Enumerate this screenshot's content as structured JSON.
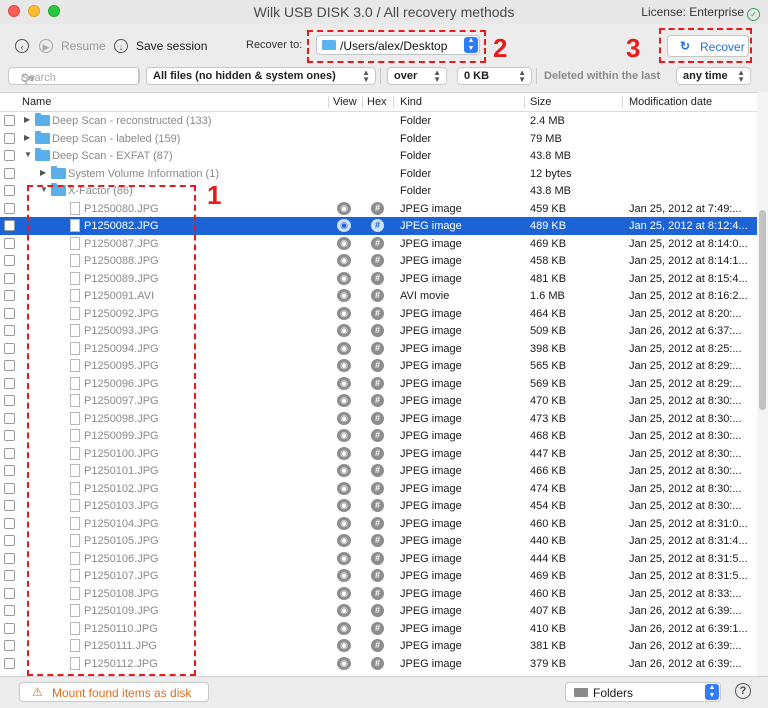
{
  "window": {
    "title": "Wilk USB DISK 3.0 / All recovery methods",
    "license": "License: Enterprise"
  },
  "toolbar": {
    "resume_label": "Resume",
    "save_session_label": "Save session",
    "recover_to_label": "Recover to:",
    "recover_path": "/Users/alex/Desktop",
    "recover_button": "Recover"
  },
  "annotations": {
    "one": "1",
    "two": "2",
    "three": "3"
  },
  "filters": {
    "search_placeholder": "Search",
    "file_filter": "All files (no hidden & system ones)",
    "size_op": "over",
    "size_value": "0 KB",
    "deleted_label": "Deleted within the last",
    "time_value": "any time"
  },
  "columns": {
    "name": "Name",
    "view": "View",
    "hex": "Hex",
    "kind": "Kind",
    "size": "Size",
    "modified": "Modification date"
  },
  "folders": [
    {
      "name": "Deep Scan - reconstructed (133)",
      "kind": "Folder",
      "size": "2.4 MB",
      "level": 0,
      "expanded": false
    },
    {
      "name": "Deep Scan - labeled (159)",
      "kind": "Folder",
      "size": "79 MB",
      "level": 0,
      "expanded": false
    },
    {
      "name": "Deep Scan - EXFAT (87)",
      "kind": "Folder",
      "size": "43.8 MB",
      "level": 0,
      "expanded": true
    },
    {
      "name": "System Volume Information (1)",
      "kind": "Folder",
      "size": "12 bytes",
      "level": 1,
      "expanded": false
    },
    {
      "name": "X-Factor (86)",
      "kind": "Folder",
      "size": "43.8 MB",
      "level": 1,
      "expanded": true
    }
  ],
  "files": [
    {
      "name": "P1250080.JPG",
      "kind": "JPEG image",
      "size": "459 KB",
      "date": "Jan 25, 2012 at 7:49:..."
    },
    {
      "name": "P1250082.JPG",
      "kind": "JPEG image",
      "size": "489 KB",
      "date": "Jan 25, 2012 at 8:12:4...",
      "selected": true
    },
    {
      "name": "P1250087.JPG",
      "kind": "JPEG image",
      "size": "469 KB",
      "date": "Jan 25, 2012 at 8:14:0..."
    },
    {
      "name": "P1250088.JPG",
      "kind": "JPEG image",
      "size": "458 KB",
      "date": "Jan 25, 2012 at 8:14:1..."
    },
    {
      "name": "P1250089.JPG",
      "kind": "JPEG image",
      "size": "481 KB",
      "date": "Jan 25, 2012 at 8:15:4..."
    },
    {
      "name": "P1250091.AVI",
      "kind": "AVI movie",
      "size": "1.6 MB",
      "date": "Jan 25, 2012 at 8:16:2..."
    },
    {
      "name": "P1250092.JPG",
      "kind": "JPEG image",
      "size": "464 KB",
      "date": "Jan 25, 2012 at 8:20:..."
    },
    {
      "name": "P1250093.JPG",
      "kind": "JPEG image",
      "size": "509 KB",
      "date": "Jan 26, 2012 at 6:37:..."
    },
    {
      "name": "P1250094.JPG",
      "kind": "JPEG image",
      "size": "398 KB",
      "date": "Jan 25, 2012 at 8:25:..."
    },
    {
      "name": "P1250095.JPG",
      "kind": "JPEG image",
      "size": "565 KB",
      "date": "Jan 25, 2012 at 8:29:..."
    },
    {
      "name": "P1250096.JPG",
      "kind": "JPEG image",
      "size": "569 KB",
      "date": "Jan 25, 2012 at 8:29:..."
    },
    {
      "name": "P1250097.JPG",
      "kind": "JPEG image",
      "size": "470 KB",
      "date": "Jan 25, 2012 at 8:30:..."
    },
    {
      "name": "P1250098.JPG",
      "kind": "JPEG image",
      "size": "473 KB",
      "date": "Jan 25, 2012 at 8:30:..."
    },
    {
      "name": "P1250099.JPG",
      "kind": "JPEG image",
      "size": "468 KB",
      "date": "Jan 25, 2012 at 8:30:..."
    },
    {
      "name": "P1250100.JPG",
      "kind": "JPEG image",
      "size": "447 KB",
      "date": "Jan 25, 2012 at 8:30:..."
    },
    {
      "name": "P1250101.JPG",
      "kind": "JPEG image",
      "size": "466 KB",
      "date": "Jan 25, 2012 at 8:30:..."
    },
    {
      "name": "P1250102.JPG",
      "kind": "JPEG image",
      "size": "474 KB",
      "date": "Jan 25, 2012 at 8:30:..."
    },
    {
      "name": "P1250103.JPG",
      "kind": "JPEG image",
      "size": "454 KB",
      "date": "Jan 25, 2012 at 8:30:..."
    },
    {
      "name": "P1250104.JPG",
      "kind": "JPEG image",
      "size": "460 KB",
      "date": "Jan 25, 2012 at 8:31:0..."
    },
    {
      "name": "P1250105.JPG",
      "kind": "JPEG image",
      "size": "440 KB",
      "date": "Jan 25, 2012 at 8:31:4..."
    },
    {
      "name": "P1250106.JPG",
      "kind": "JPEG image",
      "size": "444 KB",
      "date": "Jan 25, 2012 at 8:31:5..."
    },
    {
      "name": "P1250107.JPG",
      "kind": "JPEG image",
      "size": "469 KB",
      "date": "Jan 25, 2012 at 8:31:5..."
    },
    {
      "name": "P1250108.JPG",
      "kind": "JPEG image",
      "size": "460 KB",
      "date": "Jan 25, 2012 at 8:33:..."
    },
    {
      "name": "P1250109.JPG",
      "kind": "JPEG image",
      "size": "407 KB",
      "date": "Jan 26, 2012 at 6:39:..."
    },
    {
      "name": "P1250110.JPG",
      "kind": "JPEG image",
      "size": "410 KB",
      "date": "Jan 26, 2012 at 6:39:1..."
    },
    {
      "name": "P1250111.JPG",
      "kind": "JPEG image",
      "size": "381 KB",
      "date": "Jan 26, 2012 at 6:39:..."
    },
    {
      "name": "P1250112.JPG",
      "kind": "JPEG image",
      "size": "379 KB",
      "date": "Jan 26, 2012 at 6:39:..."
    }
  ],
  "bottom": {
    "mount_label": "Mount found items as disk",
    "view_mode": "Folders"
  },
  "colors": {
    "selection": "#1c64d6",
    "annotation": "#e41c1c",
    "accent": "#2470d8",
    "mount": "#e56a1b"
  }
}
